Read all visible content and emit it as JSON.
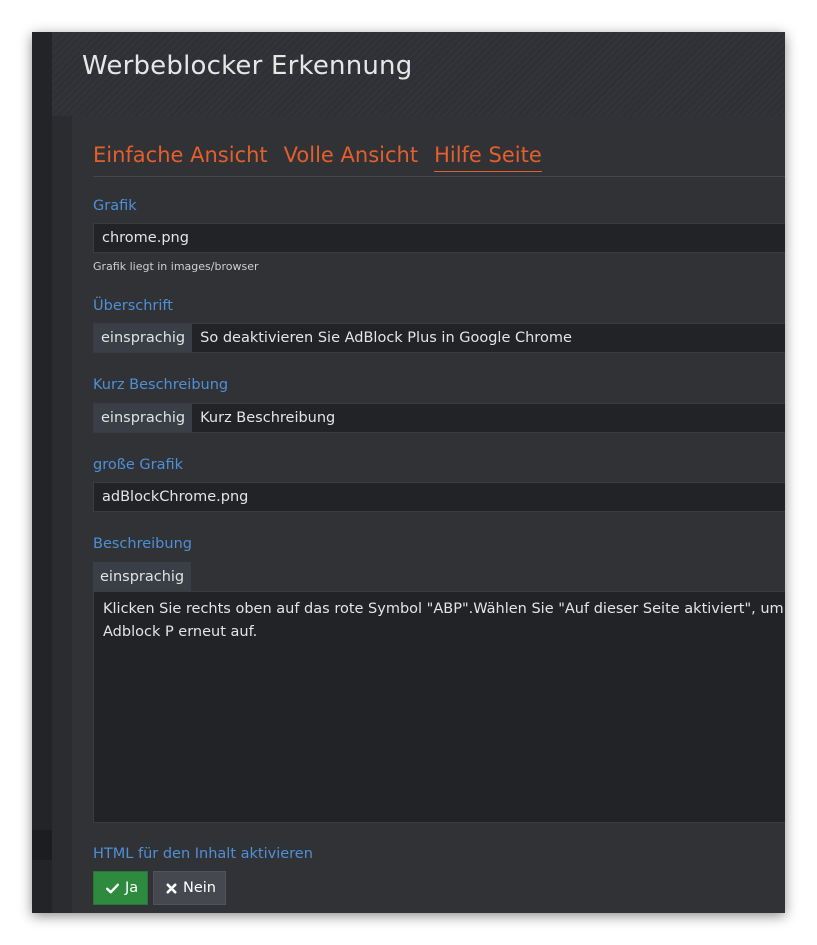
{
  "page": {
    "title": "Werbeblocker Erkennung"
  },
  "tabs": [
    {
      "label": "Einfache Ansicht",
      "active": false
    },
    {
      "label": "Volle Ansicht",
      "active": false
    },
    {
      "label": "Hilfe Seite",
      "active": true
    }
  ],
  "form": {
    "grafik": {
      "label": "Grafik",
      "value": "chrome.png",
      "hint": "Grafik liegt in images/browser"
    },
    "ueberschrift": {
      "label": "Überschrift",
      "addon": "einsprachig",
      "value": "So deaktivieren Sie AdBlock Plus in Google Chrome"
    },
    "kurz_beschreibung": {
      "label": "Kurz Beschreibung",
      "addon": "einsprachig",
      "value": "Kurz Beschreibung"
    },
    "grosse_grafik": {
      "label": "große Grafik",
      "value": "adBlockChrome.png"
    },
    "beschreibung": {
      "label": "Beschreibung",
      "addon": "einsprachig",
      "value": "Klicken Sie rechts oben auf das rote Symbol \"ABP\".Wählen Sie \"Auf dieser Seite aktiviert\", um Adblock P erneut auf."
    },
    "html_aktivieren": {
      "label": "HTML für den Inhalt aktivieren",
      "yes_label": "Ja",
      "no_label": "Nein"
    }
  },
  "colors": {
    "accent_orange": "#e35f2c",
    "label_blue": "#4f8fd6",
    "yes_green": "#2d8a3f",
    "no_gray": "#45484f"
  },
  "icons": {
    "yes": "check-icon",
    "no": "x-icon"
  }
}
